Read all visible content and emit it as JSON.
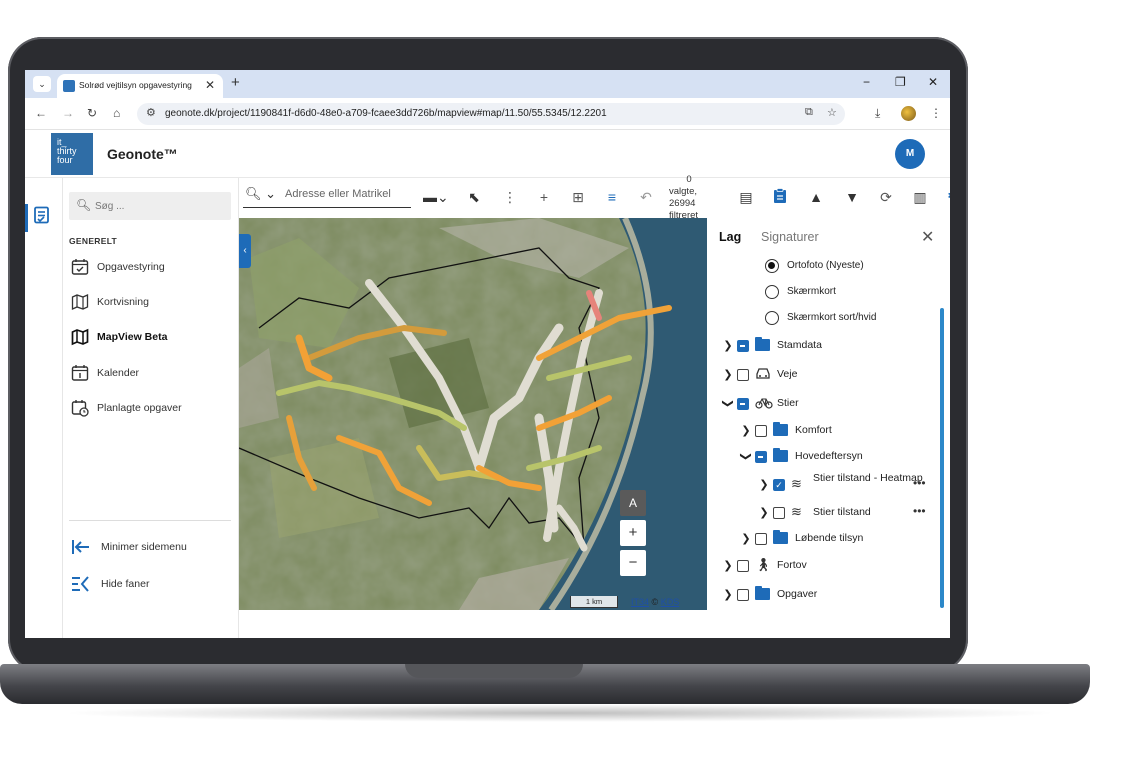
{
  "browser": {
    "tab_title": "Solrød vejtilsyn opgavestyring",
    "url": "geonote.dk/project/1190841f-d6d0-48e0-a709-fcaee3dd726b/mapview#map/11.50/55.5345/12.2201",
    "tab_close": "✕",
    "new_tab": "+",
    "min": "−",
    "max": "❐",
    "close": "✕"
  },
  "app": {
    "logo_line1": "it_",
    "logo_line2": "thirty",
    "logo_line3": "four",
    "title": "Geonote™",
    "user_initial": "M",
    "brand_color": "#1e6bb8"
  },
  "sidebar": {
    "search_placeholder": "Søg ...",
    "section_label": "GENERELT",
    "items": [
      {
        "label": "Opgavestyring",
        "icon": "calendar-check-icon"
      },
      {
        "label": "Kortvisning",
        "icon": "map-icon"
      },
      {
        "label": "MapView Beta",
        "icon": "map-icon",
        "active": true
      },
      {
        "label": "Kalender",
        "icon": "calendar-icon"
      },
      {
        "label": "Planlagte opgaver",
        "icon": "calendar-clock-icon"
      }
    ],
    "footer": [
      {
        "label": "Minimer sidemenu",
        "icon": "collapse-left-icon"
      },
      {
        "label": "Hide faner",
        "icon": "hide-tabs-icon"
      }
    ]
  },
  "toolbar": {
    "address_placeholder": "Adresse eller Matrikel",
    "selection_line1": "0",
    "selection_line2": "valgte,",
    "selection_line3": "26994",
    "selection_line4": "filtreret"
  },
  "map": {
    "scale_label": "1 km",
    "attribution_a": "IT34",
    "attribution_sep": "©",
    "attribution_b": "KDS",
    "compass_label": "A",
    "zoom_in": "+",
    "zoom_out": "−"
  },
  "panel": {
    "tab_layers": "Lag",
    "tab_signatures": "Signaturer",
    "basemaps": [
      {
        "label": "Ortofoto (Nyeste)",
        "selected": true
      },
      {
        "label": "Skærmkort",
        "selected": false
      },
      {
        "label": "Skærmkort sort/hvid",
        "selected": false
      }
    ],
    "layers": {
      "stamdata": "Stamdata",
      "veje": "Veje",
      "stier": "Stier",
      "komfort": "Komfort",
      "hovedeftersyn": "Hovedeftersyn",
      "stier_heatmap": "Stier tilstand - Heatmap",
      "stier_tilstand": "Stier tilstand",
      "lobende": "Løbende tilsyn",
      "fortov": "Fortov",
      "opgaver": "Opgaver"
    },
    "more": "•••"
  }
}
